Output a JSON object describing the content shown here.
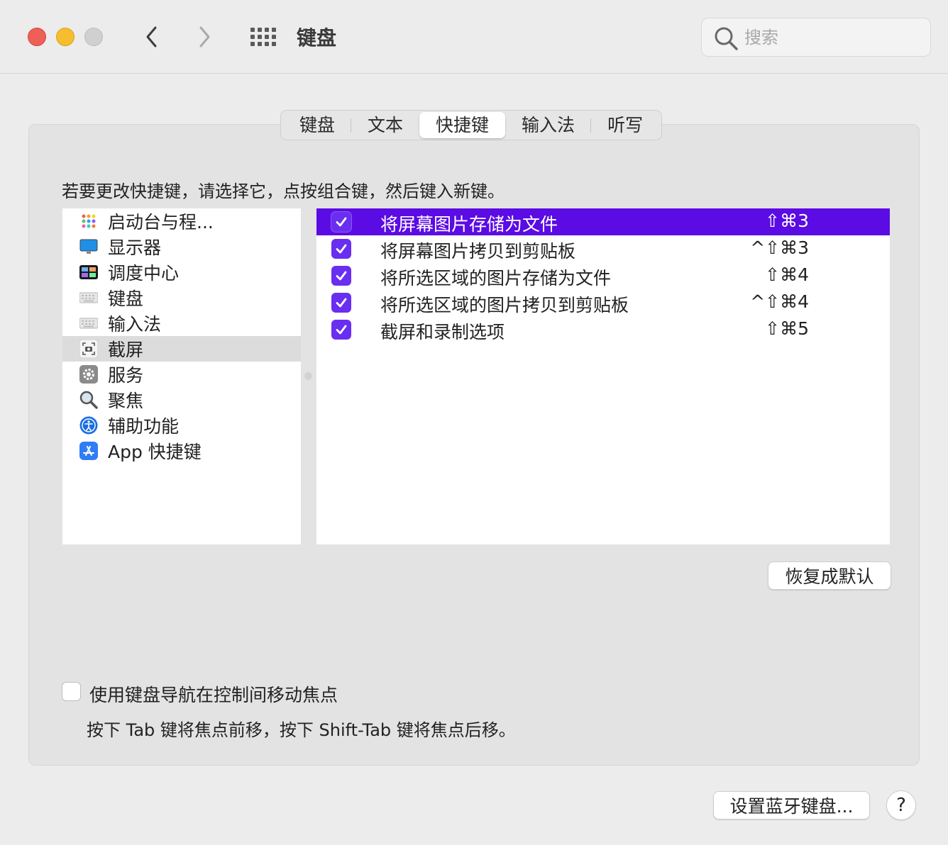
{
  "window": {
    "title": "键盘",
    "search_placeholder": "搜索"
  },
  "tabs": [
    {
      "label": "键盘",
      "active": false
    },
    {
      "label": "文本",
      "active": false
    },
    {
      "label": "快捷键",
      "active": true
    },
    {
      "label": "输入法",
      "active": false
    },
    {
      "label": "听写",
      "active": false
    }
  ],
  "instruction": "若要更改快捷键，请选择它，点按组合键，然后键入新键。",
  "categories": [
    {
      "label": "启动台与程...",
      "icon": "launchpad-icon"
    },
    {
      "label": "显示器",
      "icon": "display-icon"
    },
    {
      "label": "调度中心",
      "icon": "mission-control-icon"
    },
    {
      "label": "键盘",
      "icon": "keyboard-icon"
    },
    {
      "label": "输入法",
      "icon": "input-method-icon"
    },
    {
      "label": "截屏",
      "icon": "screenshot-icon",
      "selected": true
    },
    {
      "label": "服务",
      "icon": "services-gear-icon"
    },
    {
      "label": "聚焦",
      "icon": "spotlight-magnifier-icon"
    },
    {
      "label": "辅助功能",
      "icon": "accessibility-icon"
    },
    {
      "label": "App 快捷键",
      "icon": "app-store-icon"
    }
  ],
  "shortcuts": [
    {
      "name": "将屏幕图片存储为文件",
      "keys": "⇧⌘3",
      "checked": true,
      "selected": true
    },
    {
      "name": "将屏幕图片拷贝到剪贴板",
      "keys": "^⇧⌘3",
      "checked": true,
      "selected": false
    },
    {
      "name": "将所选区域的图片存储为文件",
      "keys": "⇧⌘4",
      "checked": true,
      "selected": false
    },
    {
      "name": "将所选区域的图片拷贝到剪贴板",
      "keys": "^⇧⌘4",
      "checked": true,
      "selected": false
    },
    {
      "name": "截屏和录制选项",
      "keys": "⇧⌘5",
      "checked": true,
      "selected": false
    }
  ],
  "buttons": {
    "restore_defaults": "恢复成默认",
    "bluetooth_keyboard": "设置蓝牙键盘...",
    "help": "?"
  },
  "keyboard_navigation": {
    "label": "使用键盘导航在控制间移动焦点",
    "checked": false,
    "hint": "按下 Tab 键将焦点前移，按下 Shift-Tab 键将焦点后移。"
  },
  "colors": {
    "selection": "#5b0be3",
    "checkbox": "#6a2ef0",
    "close": "#ee5f57",
    "minimize": "#f6bd2e"
  }
}
